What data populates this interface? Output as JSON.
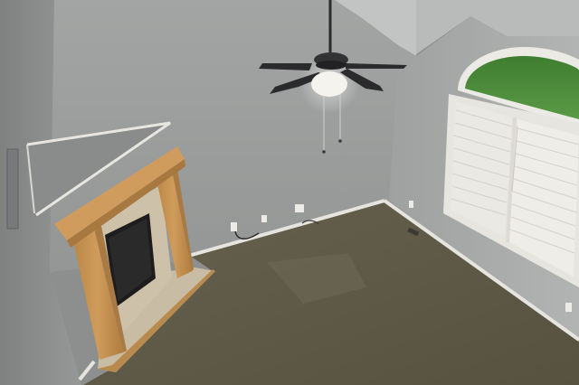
{
  "scene": {
    "colors": {
      "left_wall": "#8e908f",
      "back_wall": "#9c9e9d",
      "right_wall": "#a7a9a8",
      "ceiling": "#b9bbba",
      "carpet": "#5f5a4a",
      "carpet_light": "#6e6a58",
      "trim": "#e6e4de",
      "mantel_wood": "#c89558",
      "mantel_shadow": "#a97a43",
      "hearth_tile": "#c9bca4",
      "firebox": "#1d1d1d",
      "fan_blade": "#2b2b2d",
      "fan_light": "#f4f3ee",
      "lawn": "#4e8b3c",
      "blind": "#ebe9e3"
    }
  }
}
